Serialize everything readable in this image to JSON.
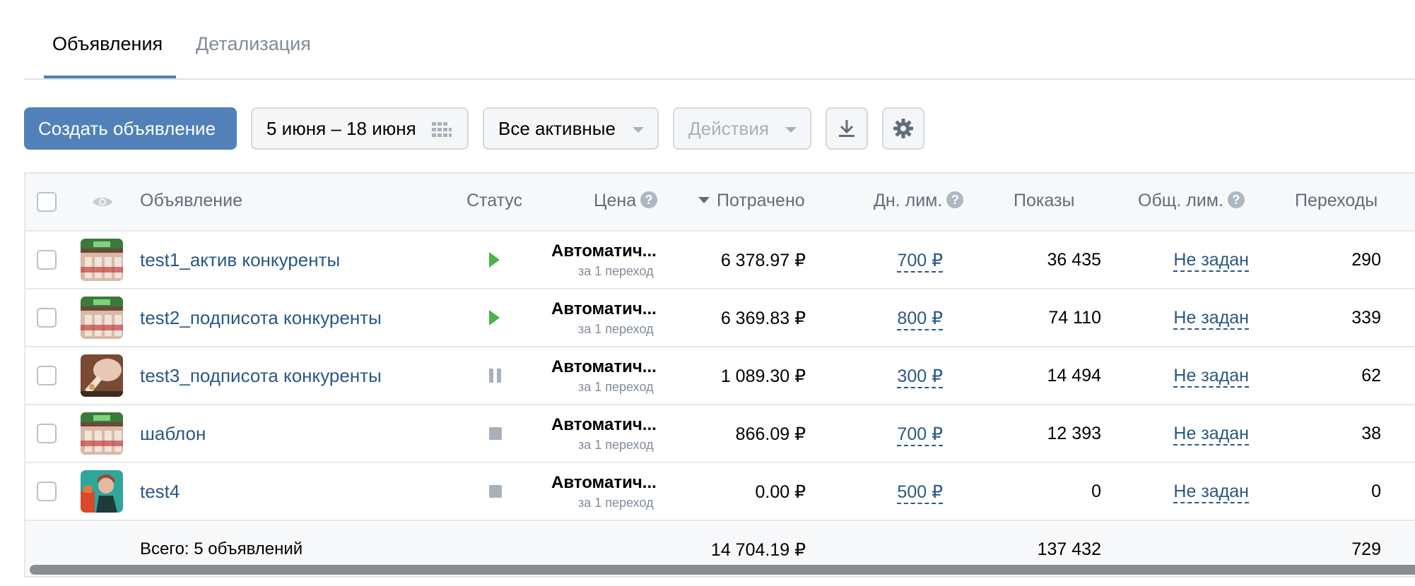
{
  "tabs": [
    {
      "label": "Объявления",
      "active": true
    },
    {
      "label": "Детализация",
      "active": false
    }
  ],
  "toolbar": {
    "create_label": "Создать объявление",
    "date_range": "5 июня – 18 июня",
    "filter_label": "Все активные",
    "actions_label": "Действия",
    "download_icon": "download-icon",
    "settings_icon": "gear-icon"
  },
  "table": {
    "headers": {
      "ad": "Объявление",
      "status": "Статус",
      "price": "Цена",
      "spent": "Потрачено",
      "daily_limit": "Дн. лим.",
      "impressions": "Показы",
      "total_limit": "Общ. лим.",
      "clicks": "Переходы",
      "help_glyph": "?"
    },
    "rows": [
      {
        "name": "test1_актив конкуренты",
        "status": "active",
        "price": "Автоматич...",
        "price_sub": "за 1 переход",
        "spent": "6 378.97 ₽",
        "daily_limit": "700 ₽",
        "impressions": "36 435",
        "total_limit": "Не задан",
        "clicks": "290"
      },
      {
        "name": "test2_подписота конкуренты",
        "status": "active",
        "price": "Автоматич...",
        "price_sub": "за 1 переход",
        "spent": "6 369.83 ₽",
        "daily_limit": "800 ₽",
        "impressions": "74 110",
        "total_limit": "Не задан",
        "clicks": "339"
      },
      {
        "name": "test3_подписота конкуренты",
        "status": "paused",
        "price": "Автоматич...",
        "price_sub": "за 1 переход",
        "spent": "1 089.30 ₽",
        "daily_limit": "300 ₽",
        "impressions": "14 494",
        "total_limit": "Не задан",
        "clicks": "62"
      },
      {
        "name": "шаблон",
        "status": "stopped",
        "price": "Автоматич...",
        "price_sub": "за 1 переход",
        "spent": "866.09 ₽",
        "daily_limit": "700 ₽",
        "impressions": "12 393",
        "total_limit": "Не задан",
        "clicks": "38"
      },
      {
        "name": "test4",
        "status": "stopped",
        "price": "Автоматич...",
        "price_sub": "за 1 переход",
        "spent": "0.00 ₽",
        "daily_limit": "500 ₽",
        "impressions": "0",
        "total_limit": "Не задан",
        "clicks": "0"
      }
    ],
    "total": {
      "label": "Всего: 5 объявлений",
      "spent": "14 704.19 ₽",
      "impressions": "137 432",
      "clicks": "729"
    }
  },
  "colors": {
    "accent": "#5181b8",
    "link": "#2a5885",
    "status_active": "#4bb34b",
    "status_inactive": "#a8b0b9"
  }
}
